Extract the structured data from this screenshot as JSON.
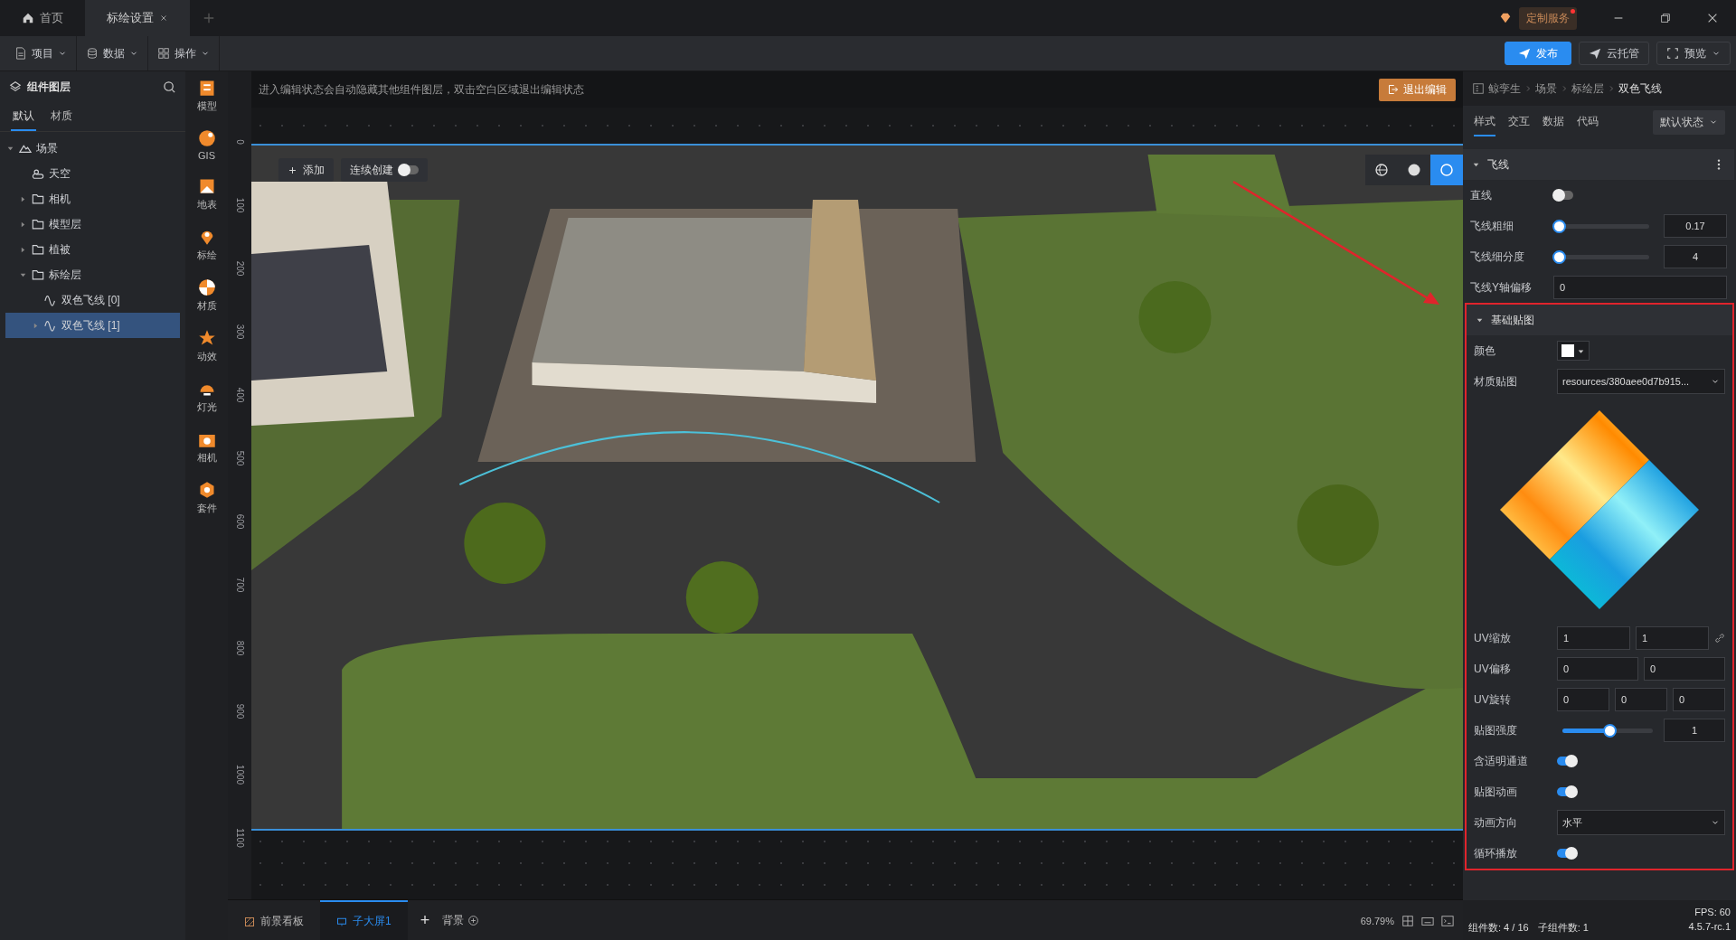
{
  "tabs": [
    {
      "label": "首页",
      "selected": false,
      "closable": false
    },
    {
      "label": "标绘设置",
      "selected": true,
      "closable": true
    }
  ],
  "service": {
    "label": "定制服务",
    "badge": true
  },
  "toolbar": {
    "menus": [
      {
        "label": "项目"
      },
      {
        "label": "数据"
      },
      {
        "label": "操作"
      }
    ],
    "buttons": [
      {
        "label": "发布",
        "kind": "primary"
      },
      {
        "label": "云托管",
        "kind": "default"
      },
      {
        "label": "预览",
        "kind": "dropdown"
      }
    ]
  },
  "layers_panel": {
    "title": "组件图层",
    "tabs": [
      {
        "label": "默认",
        "selected": true
      },
      {
        "label": "材质",
        "selected": false
      }
    ],
    "tree": [
      {
        "label": "场景",
        "kind": "scene",
        "expanded": true,
        "selected": false,
        "children": [
          {
            "label": "天空",
            "kind": "sky",
            "selected": false
          },
          {
            "label": "相机",
            "kind": "folder",
            "expanded": false,
            "selected": false
          },
          {
            "label": "模型层",
            "kind": "folder",
            "expanded": false,
            "selected": false
          },
          {
            "label": "植被",
            "kind": "folder",
            "expanded": false,
            "selected": false
          },
          {
            "label": "标绘层",
            "kind": "folder",
            "expanded": true,
            "selected": false,
            "children": [
              {
                "label": "双色飞线 [0]",
                "kind": "line",
                "selected": false
              },
              {
                "label": "双色飞线 [1]",
                "kind": "line",
                "expanded": false,
                "selected": true
              }
            ]
          }
        ]
      }
    ]
  },
  "tool_strip": [
    {
      "label": "模型"
    },
    {
      "label": "GIS"
    },
    {
      "label": "地表"
    },
    {
      "label": "标绘"
    },
    {
      "label": "材质"
    },
    {
      "label": "动效"
    },
    {
      "label": "灯光"
    },
    {
      "label": "相机"
    },
    {
      "label": "套件"
    }
  ],
  "canvas": {
    "notice": "进入编辑状态会自动隐藏其他组件图层，双击空白区域退出编辑状态",
    "exit_button": "退出编辑",
    "side_ruler": [
      "0",
      "100",
      "200",
      "300",
      "400",
      "500",
      "600",
      "700",
      "800",
      "900",
      "1000",
      "1100"
    ],
    "add_button": "添加",
    "continuous": {
      "label": "连续创建",
      "on": false
    },
    "view_buttons": [
      {
        "selected": false
      },
      {
        "selected": false
      },
      {
        "selected": true
      }
    ],
    "annotation_arrow": true
  },
  "bottom_bar": {
    "tabs": [
      {
        "label": "前景看板",
        "selected": false
      },
      {
        "label": "子大屏1",
        "selected": true
      }
    ],
    "add": "+",
    "background": "背景",
    "zoom": "69.79%"
  },
  "properties": {
    "breadcrumb": [
      "鲸孪生",
      "场景",
      "标绘层",
      "双色飞线"
    ],
    "tabs": [
      {
        "label": "样式",
        "selected": true
      },
      {
        "label": "交互",
        "selected": false
      },
      {
        "label": "数据",
        "selected": false
      },
      {
        "label": "代码",
        "selected": false
      }
    ],
    "state_select": "默认状态",
    "sections": [
      {
        "title": "飞线",
        "expanded": true,
        "highlighted": false,
        "menu": true,
        "rows": [
          {
            "kind": "toggle",
            "label": "直线",
            "on": false
          },
          {
            "kind": "slider",
            "label": "飞线粗细",
            "level": 0,
            "value": "0.17"
          },
          {
            "kind": "slider",
            "label": "飞线细分度",
            "level": 0,
            "value": "4"
          },
          {
            "kind": "input",
            "label": "飞线Y轴偏移",
            "value": "0"
          }
        ]
      },
      {
        "title": "基础贴图",
        "expanded": true,
        "highlighted": true,
        "menu": false,
        "rows": [
          {
            "kind": "color",
            "label": "颜色",
            "color": "#ffffff"
          },
          {
            "kind": "select",
            "label": "材质贴图",
            "value": "resources/380aee0d7b915..."
          },
          {
            "kind": "texture"
          },
          {
            "kind": "inputs",
            "label": "UV缩放",
            "values": [
              "1",
              "1"
            ],
            "linked": true
          },
          {
            "kind": "inputs",
            "label": "UV偏移",
            "values": [
              "0",
              "0"
            ],
            "linked": false
          },
          {
            "kind": "inputs",
            "label": "UV旋转",
            "values": [
              "0",
              "0",
              "0"
            ],
            "linked": false
          },
          {
            "kind": "slider",
            "label": "贴图强度",
            "level": 0.52,
            "value": "1"
          },
          {
            "kind": "toggle",
            "label": "含适明通道",
            "on": true
          },
          {
            "kind": "toggle",
            "label": "贴图动画",
            "on": true
          },
          {
            "kind": "select",
            "label": "动画方向",
            "value": "水平"
          },
          {
            "kind": "toggle",
            "label": "循环播放",
            "on": true
          }
        ]
      }
    ]
  },
  "status": {
    "fps": "FPS: 60",
    "counts": [
      "组件数: 4 / 16",
      "子组件数: 1"
    ],
    "version": "4.5.7-rc.1"
  }
}
